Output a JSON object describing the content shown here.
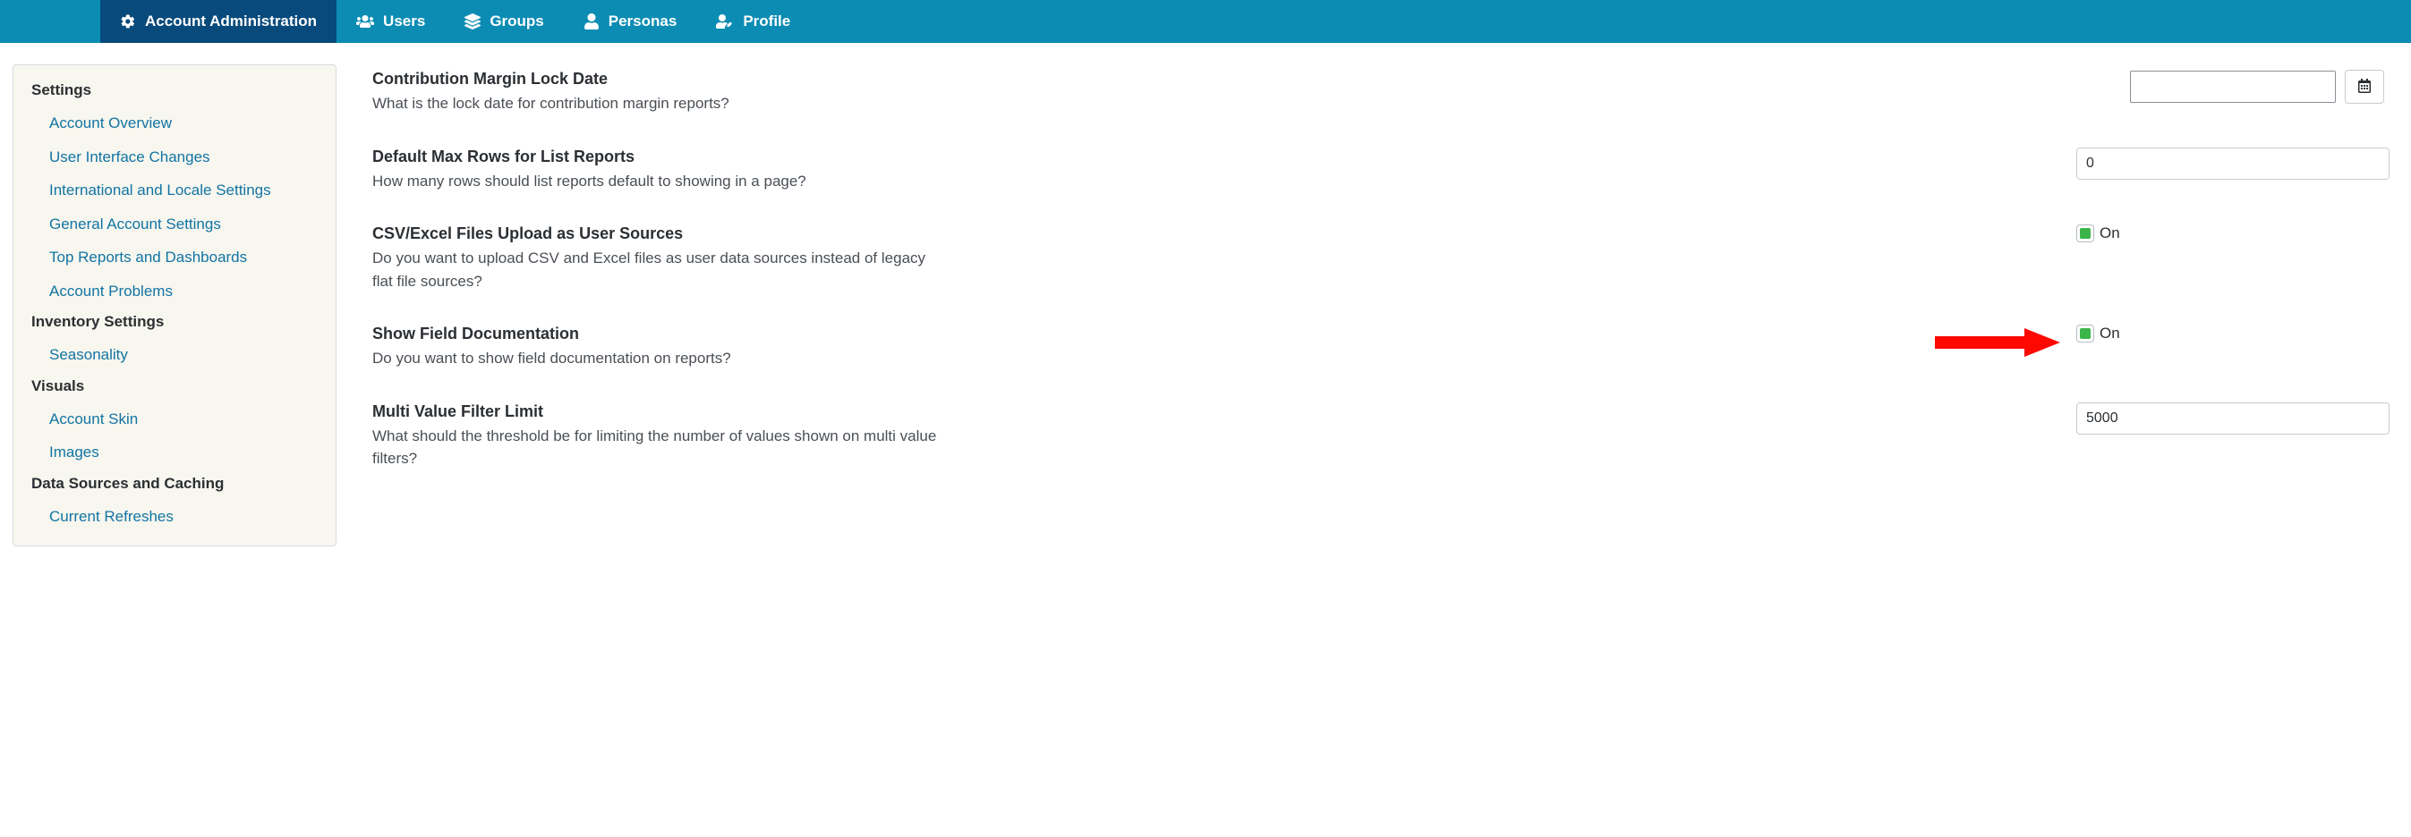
{
  "topnav": {
    "items": [
      {
        "label": "Account Administration"
      },
      {
        "label": "Users"
      },
      {
        "label": "Groups"
      },
      {
        "label": "Personas"
      },
      {
        "label": "Profile"
      }
    ]
  },
  "sidebar": {
    "sections": [
      {
        "title": "Settings",
        "links": [
          "Account Overview",
          "User Interface Changes",
          "International and Locale Settings",
          "General Account Settings",
          "Top Reports and Dashboards",
          "Account Problems"
        ]
      },
      {
        "title": "Inventory Settings",
        "links": [
          "Seasonality"
        ]
      },
      {
        "title": "Visuals",
        "links": [
          "Account Skin",
          "Images"
        ]
      },
      {
        "title": "Data Sources and Caching",
        "links": [
          "Current Refreshes"
        ]
      }
    ]
  },
  "settings": {
    "lockDate": {
      "title": "Contribution Margin Lock Date",
      "desc": "What is the lock date for contribution margin reports?",
      "value": ""
    },
    "maxRows": {
      "title": "Default Max Rows for List Reports",
      "desc": "How many rows should list reports default to showing in a page?",
      "value": "0"
    },
    "csvUpload": {
      "title": "CSV/Excel Files Upload as User Sources",
      "desc": "Do you want to upload CSV and Excel files as user data sources instead of legacy flat file sources?",
      "state": "On"
    },
    "fieldDoc": {
      "title": "Show Field Documentation",
      "desc": "Do you want to show field documentation on reports?",
      "state": "On"
    },
    "filterLimit": {
      "title": "Multi Value Filter Limit",
      "desc": "What should the threshold be for limiting the number of values shown on multi value filters?",
      "value": "5000"
    }
  }
}
